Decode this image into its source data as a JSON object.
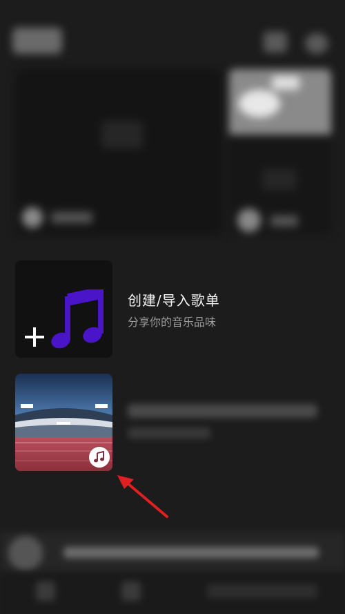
{
  "create_playlist": {
    "title": "创建/导入歌单",
    "subtitle": "分享你的音乐品味",
    "note_color": "#4a14c8"
  },
  "playlist": {
    "cover_icon": "stadium-cover-image",
    "badge_icon": "music-note-icon"
  },
  "annotation": {
    "arrow_color": "#e02020"
  }
}
